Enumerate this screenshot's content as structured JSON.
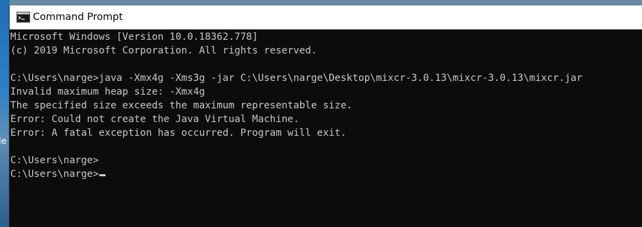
{
  "desktop": {
    "label": "le"
  },
  "window": {
    "title": "Command Prompt",
    "icon": "cmd-icon"
  },
  "console": {
    "lines": [
      "Microsoft Windows [Version 10.0.18362.778]",
      "(c) 2019 Microsoft Corporation. All rights reserved.",
      "",
      "C:\\Users\\narge>java -Xmx4g -Xms3g -jar C:\\Users\\narge\\Desktop\\mixcr-3.0.13\\mixcr-3.0.13\\mixcr.jar",
      "Invalid maximum heap size: -Xmx4g",
      "The specified size exceeds the maximum representable size.",
      "Error: Could not create the Java Virtual Machine.",
      "Error: A fatal exception has occurred. Program will exit.",
      "",
      "C:\\Users\\narge>",
      "C:\\Users\\narge>"
    ]
  },
  "colors": {
    "console_background": "#0c0c0c",
    "console_text": "#c8c8c8",
    "titlebar_background": "#ffffff"
  }
}
